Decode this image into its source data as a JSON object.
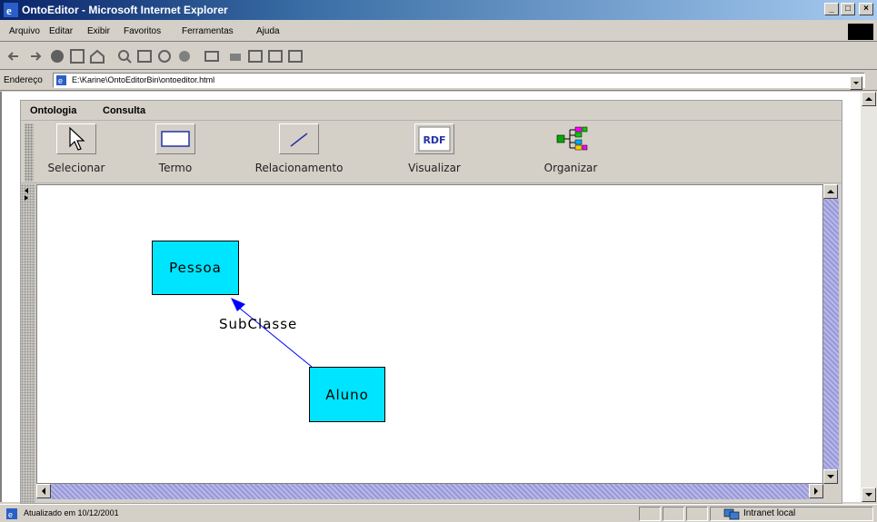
{
  "window": {
    "title": "OntoEditor - Microsoft Internet Explorer"
  },
  "browser_menu": [
    "Arquivo",
    "Editar",
    "Exibir",
    "Favoritos",
    "Ferramentas",
    "Ajuda"
  ],
  "address": {
    "label": "Endereço",
    "value": "E:\\Karine\\OntoEditorBin\\ontoeditor.html"
  },
  "applet_menu": {
    "ontologia": "Ontologia",
    "consulta": "Consulta"
  },
  "tools": [
    {
      "label": "Selecionar",
      "icon": "arrow-cursor-icon"
    },
    {
      "label": "Termo",
      "icon": "rectangle-icon"
    },
    {
      "label": "Relacionamento",
      "icon": "line-icon"
    },
    {
      "label": "Visualizar",
      "icon": "rdf-icon",
      "icon_text": "RDF"
    },
    {
      "label": "Organizar",
      "icon": "hierarchy-icon"
    }
  ],
  "diagram": {
    "nodes": [
      {
        "id": "pessoa",
        "label": "Pessoa"
      },
      {
        "id": "aluno",
        "label": "Aluno"
      }
    ],
    "edge": {
      "from": "aluno",
      "to": "pessoa",
      "label": "SubClasse"
    },
    "colors": {
      "node_fill": "#00e5ff",
      "edge": "#0000ff"
    }
  },
  "status": {
    "text": "Atualizado em 10/12/2001",
    "zone": "Intranet local"
  }
}
